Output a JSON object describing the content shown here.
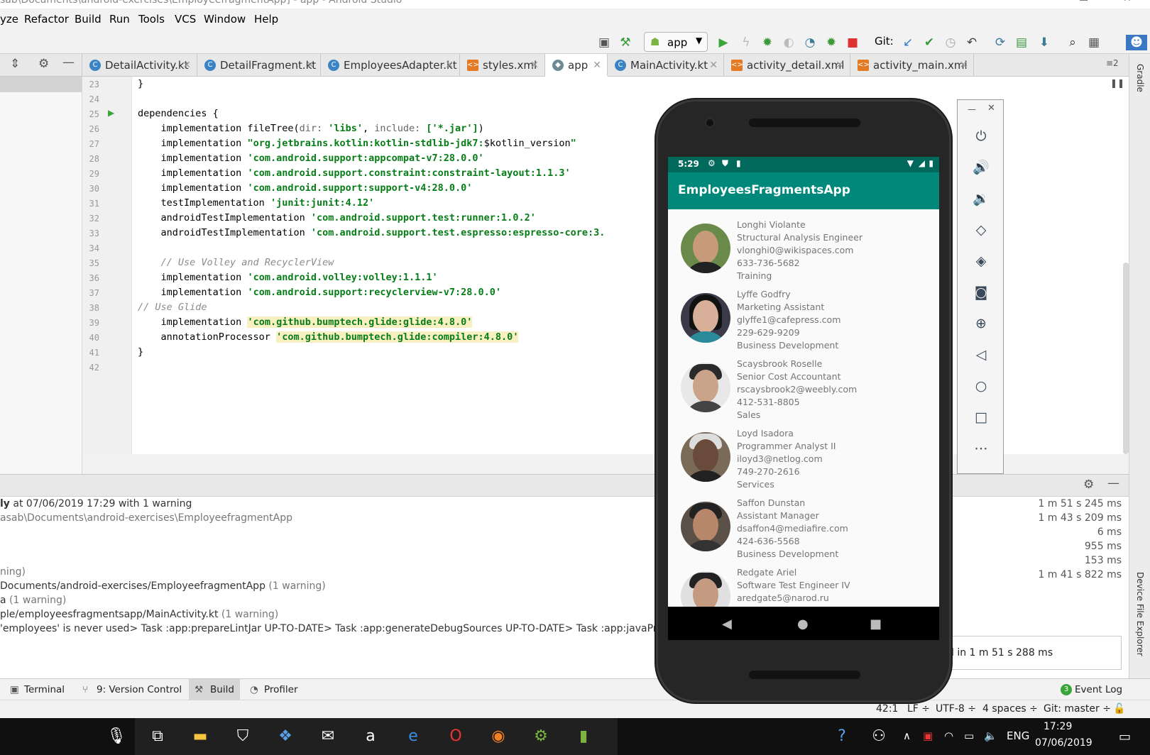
{
  "window": {
    "title": "sab\\Documents\\android-exercises\\EmployeefragmentApp] - app - Android Studio"
  },
  "menu": [
    "yze",
    "Refactor",
    "Build",
    "Run",
    "Tools",
    "VCS",
    "Window",
    "Help"
  ],
  "toolbar": {
    "run_config": "app",
    "git_label": "Git:"
  },
  "tabs": [
    {
      "label": "DetailActivity.kt",
      "icon": "kotlin-class-icon"
    },
    {
      "label": "DetailFragment.kt",
      "icon": "kotlin-class-icon"
    },
    {
      "label": "EmployeesAdapter.kt",
      "icon": "kotlin-class-icon"
    },
    {
      "label": "styles.xml",
      "icon": "xml-file-icon"
    },
    {
      "label": "app",
      "icon": "gradle-icon"
    },
    {
      "label": "MainActivity.kt",
      "icon": "kotlin-class-icon"
    },
    {
      "label": "activity_detail.xml",
      "icon": "xml-file-icon"
    },
    {
      "label": "activity_main.xml",
      "icon": "xml-file-icon"
    }
  ],
  "tabs_overflow": "≡2",
  "editor": {
    "line_numbers": [
      "23",
      "24",
      "25",
      "26",
      "27",
      "28",
      "29",
      "30",
      "31",
      "32",
      "33",
      "34",
      "35",
      "36",
      "37",
      "38",
      "39",
      "40",
      "41",
      "42"
    ],
    "lines": {
      "l23": "}",
      "l24": "",
      "l25": "dependencies {",
      "l26a": "    implementation fileTree(",
      "l26b": "dir: ",
      "l26c": "'libs'",
      "l26d": ", ",
      "l26e": "include: ",
      "l26f": "['*.jar']",
      "l26g": ")",
      "l27a": "    implementation ",
      "l27b": "\"org.jetbrains.kotlin:kotlin-stdlib-jdk7:",
      "l27c": "$kotlin_version",
      "l27d": "\"",
      "l28a": "    implementation ",
      "l28b": "'com.android.support:appcompat-v7:28.0.0'",
      "l29a": "    implementation ",
      "l29b": "'com.android.support.constraint:constraint-layout:1.1.3'",
      "l30a": "    implementation ",
      "l30b": "'com.android.support:support-v4:28.0.0'",
      "l31a": "    testImplementation ",
      "l31b": "'junit:junit:4.12'",
      "l32a": "    androidTestImplementation ",
      "l32b": "'com.android.support.test:runner:1.0.2'",
      "l33a": "    androidTestImplementation ",
      "l33b": "'com.android.support.test.espresso:espresso-core:3.",
      "l34": "",
      "l35": "    // Use Volley and RecyclerView",
      "l36a": "    implementation ",
      "l36b": "'com.android.volley:volley:1.1.1'",
      "l37a": "    implementation ",
      "l37b": "'com.android.support:recyclerview-v7:28.0.0'",
      "l38": "// Use Glide",
      "l39a": "    implementation ",
      "l39b": "'com.github.bumptech.glide:glide:4.8.0'",
      "l40a": "    annotationProcessor ",
      "l40b": "'com.github.bumptech.glide:compiler:4.8.0'",
      "l41": "}",
      "l42": ""
    }
  },
  "build": {
    "line1a": "ly",
    "line1b": " at 07/06/2019 17:29  with 1 warning",
    "line2": "asab\\Documents\\android-exercises\\EmployeefragmentApp",
    "line3": "ning)",
    "line4a": "Documents/android-exercises/EmployeefragmentApp",
    "line4b": "  (1 warning)",
    "line5a": "a",
    "line5b": "  (1 warning)",
    "line6a": "ple/employeesfragmentsapp/MainActivity.kt",
    "line6b": "  (1 warning)",
    "line7": "'employees' is never used> Task :app:prepareLintJar UP-TO-DATE> Task :app:generateDebugSources UP-TO-DATE> Task :app:javaPreCompi",
    "durations": [
      "1 m 51 s 245 ms",
      "1 m 43 s 209 ms",
      "6 ms",
      "955 ms",
      "153 ms",
      "1 m 41 s 822 ms"
    ],
    "notification": "d in 1 m 51 s 288 ms"
  },
  "tool_tabs": [
    "Terminal",
    "9: Version Control",
    "Build",
    "Profiler"
  ],
  "event_log": {
    "badge": "3",
    "label": "Event Log"
  },
  "statusbar": {
    "position": "42:1",
    "line_sep": "LF ÷",
    "encoding": "UTF-8 ÷",
    "indent": "4 spaces ÷",
    "vcs": "Git: master ÷"
  },
  "side_panels": {
    "gradle": "Gradle",
    "device_explorer": "Device File Explorer"
  },
  "phone": {
    "time": "5:29",
    "app_title": "EmployeesFragmentsApp",
    "employees": [
      {
        "name": "Longhi Violante",
        "title": "Structural Analysis Engineer",
        "email": "vlonghi0@wikispaces.com",
        "phone": "633-736-5682",
        "dept": "Training"
      },
      {
        "name": "Lyffe Godfry",
        "title": "Marketing Assistant",
        "email": "glyffe1@cafepress.com",
        "phone": "229-629-9209",
        "dept": "Business Development"
      },
      {
        "name": "Scaysbrook Roselle",
        "title": "Senior Cost Accountant",
        "email": "rscaysbrook2@weebly.com",
        "phone": "412-531-8805",
        "dept": "Sales"
      },
      {
        "name": "Loyd Isadora",
        "title": "Programmer Analyst II",
        "email": "iloyd3@netlog.com",
        "phone": "749-270-2616",
        "dept": "Services"
      },
      {
        "name": "Saffon Dunstan",
        "title": "Assistant Manager",
        "email": "dsaffon4@mediafire.com",
        "phone": "424-636-5568",
        "dept": "Business Development"
      },
      {
        "name": "Redgate Ariel",
        "title": "Software Test Engineer IV",
        "email": "aredgate5@narod.ru",
        "phone": "",
        "dept": ""
      }
    ]
  },
  "taskbar": {
    "lang": "ENG",
    "time": "17:29",
    "date": "07/06/2019"
  },
  "colors": {
    "teal_dark": "#00695c",
    "teal": "#00897b",
    "string_green": "#067d17",
    "highlight": "#f8efc3"
  }
}
